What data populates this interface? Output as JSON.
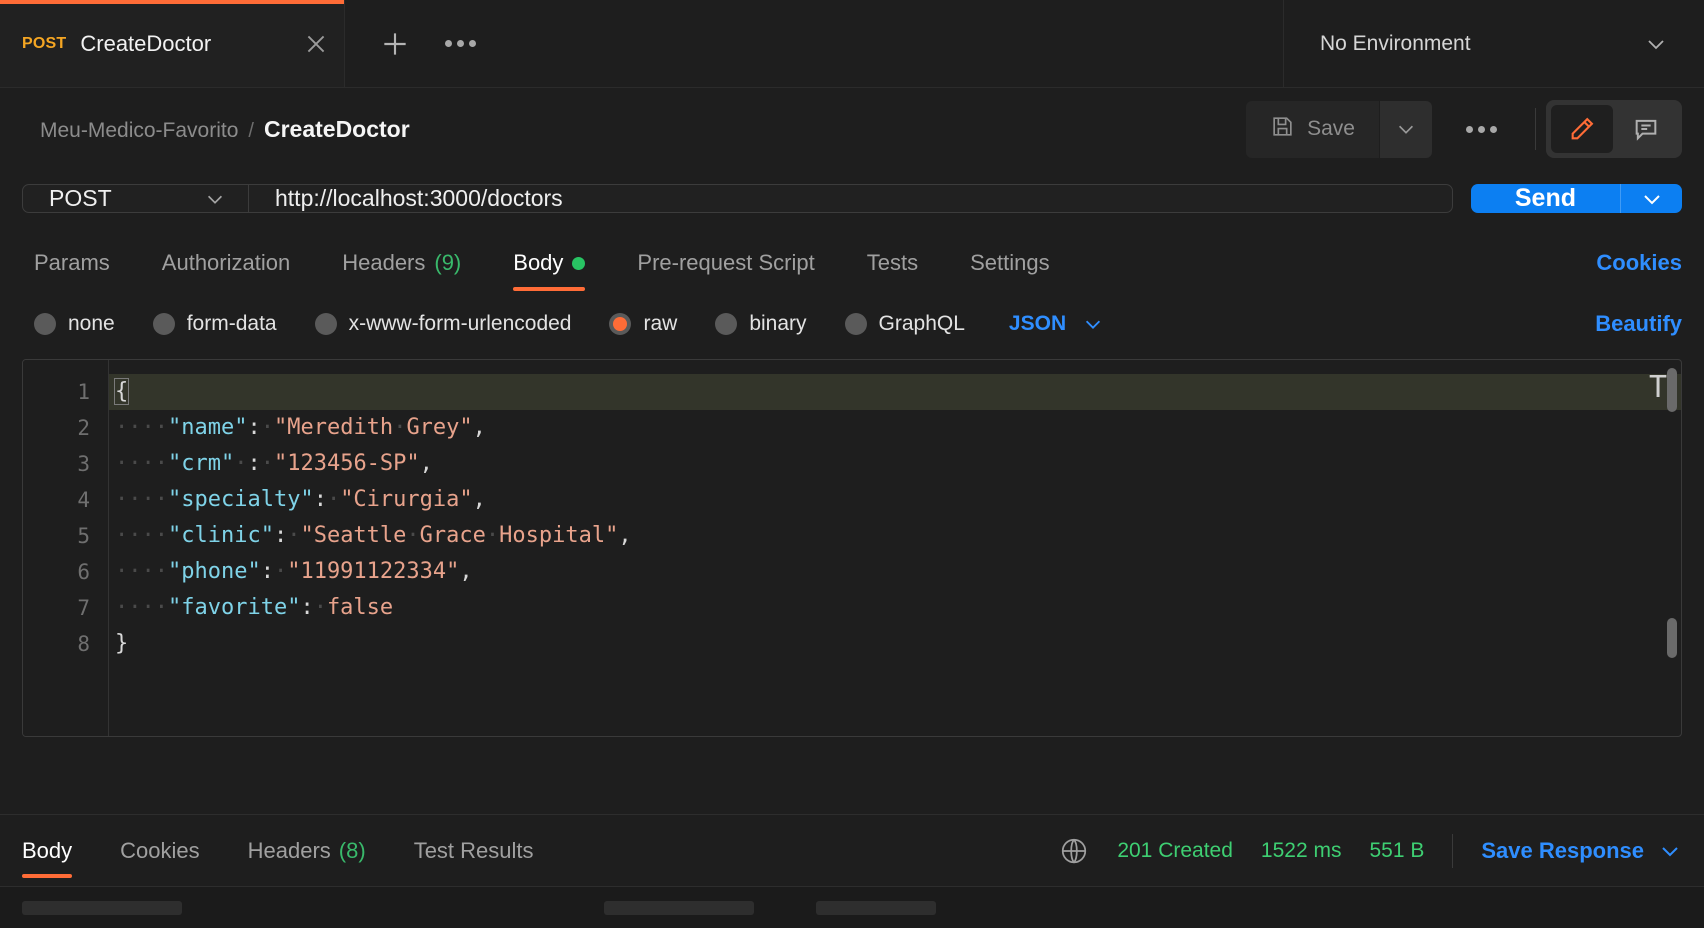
{
  "tabstrip": {
    "tab": {
      "method": "POST",
      "title": "CreateDoctor",
      "close_icon": "close-icon"
    },
    "new_tab_icon": "plus-icon",
    "more_icon": "ellipsis-icon",
    "environment": {
      "label": "No Environment",
      "caret_icon": "chevron-down-icon"
    }
  },
  "header": {
    "breadcrumb": {
      "collection": "Meu-Medico-Favorito",
      "separator": "/",
      "current": "CreateDoctor"
    },
    "save_label": "Save",
    "save_icon": "floppy-disk-icon",
    "save_caret_icon": "chevron-down-icon",
    "more_icon": "ellipsis-icon",
    "edit_icon": "pencil-icon",
    "comment_icon": "comment-icon",
    "accent_color": "#ff6c37"
  },
  "request": {
    "method": "POST",
    "method_caret_icon": "chevron-down-icon",
    "url": "http://localhost:3000/doctors",
    "send_label": "Send",
    "send_caret_icon": "chevron-down-icon",
    "send_color": "#0c7ff2"
  },
  "request_tabs": [
    {
      "label": "Params",
      "count": "",
      "dot": false,
      "active": false
    },
    {
      "label": "Authorization",
      "count": "",
      "dot": false,
      "active": false
    },
    {
      "label": "Headers",
      "count": "(9)",
      "dot": false,
      "active": false
    },
    {
      "label": "Body",
      "count": "",
      "dot": true,
      "active": true
    },
    {
      "label": "Pre-request Script",
      "count": "",
      "dot": false,
      "active": false
    },
    {
      "label": "Tests",
      "count": "",
      "dot": false,
      "active": false
    },
    {
      "label": "Settings",
      "count": "",
      "dot": false,
      "active": false
    }
  ],
  "cookies_link": "Cookies",
  "body_types": [
    {
      "label": "none",
      "selected": false
    },
    {
      "label": "form-data",
      "selected": false
    },
    {
      "label": "x-www-form-urlencoded",
      "selected": false
    },
    {
      "label": "raw",
      "selected": true
    },
    {
      "label": "binary",
      "selected": false
    },
    {
      "label": "GraphQL",
      "selected": false
    }
  ],
  "body_format": {
    "label": "JSON",
    "caret_icon": "chevron-down-icon"
  },
  "beautify_label": "Beautify",
  "editor": {
    "line_numbers": [
      "1",
      "2",
      "3",
      "4",
      "5",
      "6",
      "7",
      "8"
    ],
    "raw_text": "{\n    \"name\": \"Meredith Grey\",\n    \"crm\" : \"123456-SP\",\n    \"specialty\": \"Cirurgia\",\n    \"clinic\": \"Seattle Grace Hospital\",\n    \"phone\": \"11991122334\",\n    \"favorite\": false\n}",
    "json_body": {
      "name": "Meredith Grey",
      "crm": "123456-SP",
      "specialty": "Cirurgia",
      "clinic": "Seattle Grace Hospital",
      "phone": "11991122334",
      "favorite": false
    },
    "colors": {
      "key": "#7fd3e8",
      "string": "#e8a38c",
      "boolean": "#e8a38c",
      "punct": "#d8d8d8"
    }
  },
  "response_tabs": [
    {
      "label": "Body",
      "count": "",
      "active": true
    },
    {
      "label": "Cookies",
      "count": "",
      "active": false
    },
    {
      "label": "Headers",
      "count": "(8)",
      "active": false
    },
    {
      "label": "Test Results",
      "count": "",
      "active": false
    }
  ],
  "response_status": {
    "globe_icon": "globe-icon",
    "status": "201 Created",
    "time": "1522 ms",
    "size": "551 B",
    "color": "#3ecf72"
  },
  "save_response": {
    "label": "Save Response",
    "caret_icon": "chevron-down-icon"
  }
}
